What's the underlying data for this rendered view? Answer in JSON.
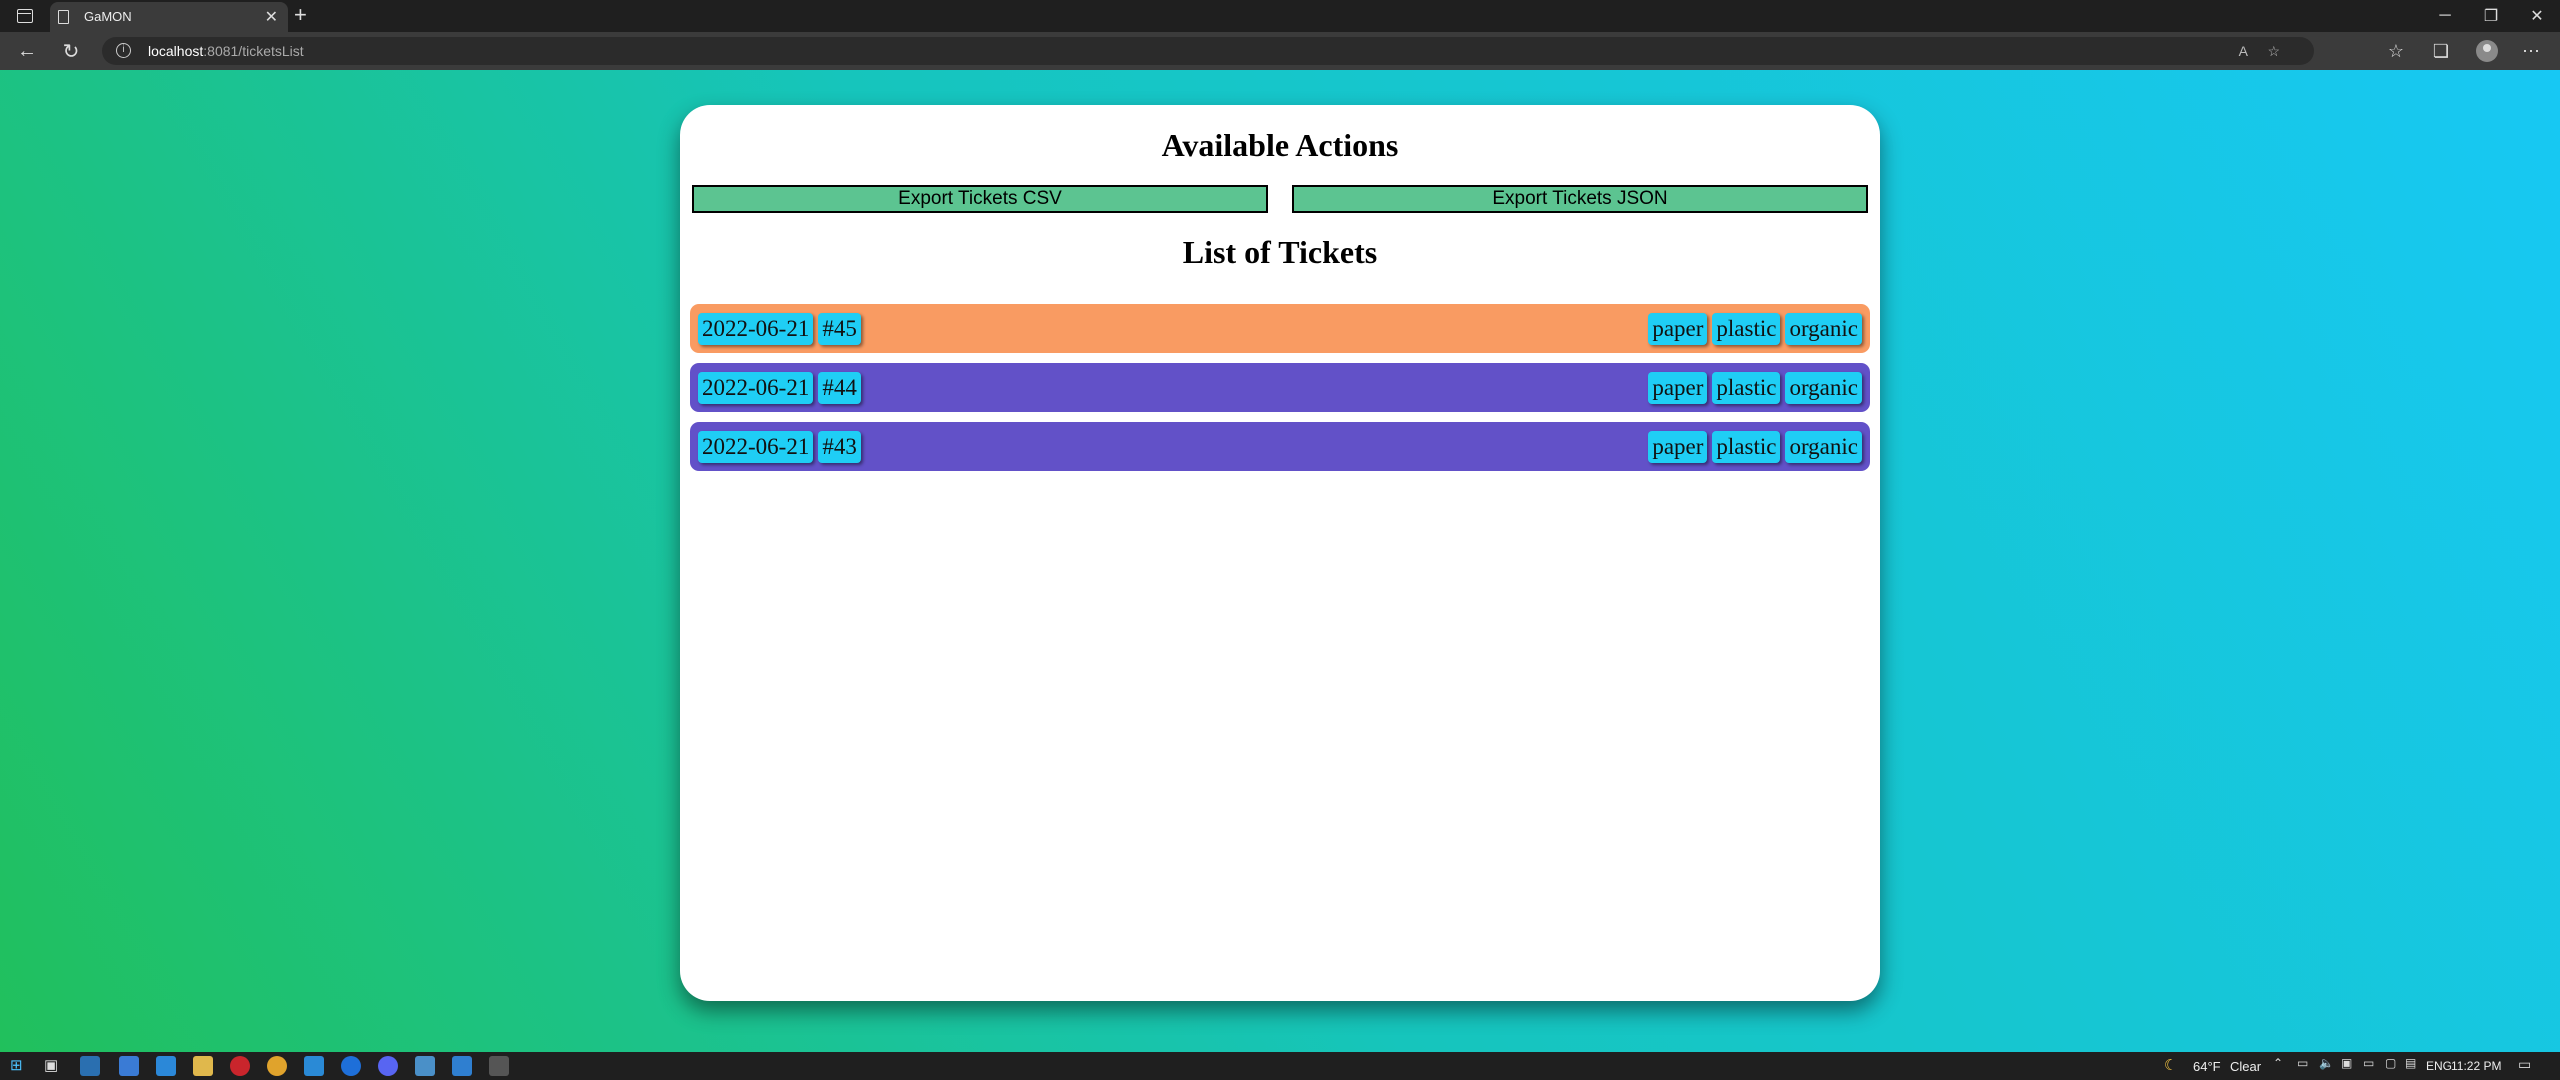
{
  "browser": {
    "tab_title": "GaMON",
    "url_host": "localhost",
    "url_rest": ":8081/ticketsList"
  },
  "page": {
    "actions_heading": "Available Actions",
    "export_csv_label": "Export Tickets CSV",
    "export_json_label": "Export Tickets JSON",
    "list_heading": "List of Tickets",
    "tickets": [
      {
        "date": "2022-06-21",
        "number": "#45",
        "tags": [
          "paper",
          "plastic",
          "organic"
        ],
        "color": "#f99b62"
      },
      {
        "date": "2022-06-21",
        "number": "#44",
        "tags": [
          "paper",
          "plastic",
          "organic"
        ],
        "color": "#6251c8"
      },
      {
        "date": "2022-06-21",
        "number": "#43",
        "tags": [
          "paper",
          "plastic",
          "organic"
        ],
        "color": "#6251c8"
      }
    ]
  },
  "taskbar": {
    "weather_temp": "64°F",
    "weather_desc": "Clear",
    "language": "ENG",
    "time": "11:22 PM"
  },
  "colors": {
    "export_button": "#5cc491",
    "chip": "#1fcef5",
    "bg_gradient_start": "#21c05c",
    "bg_gradient_end": "#17c8f4"
  }
}
